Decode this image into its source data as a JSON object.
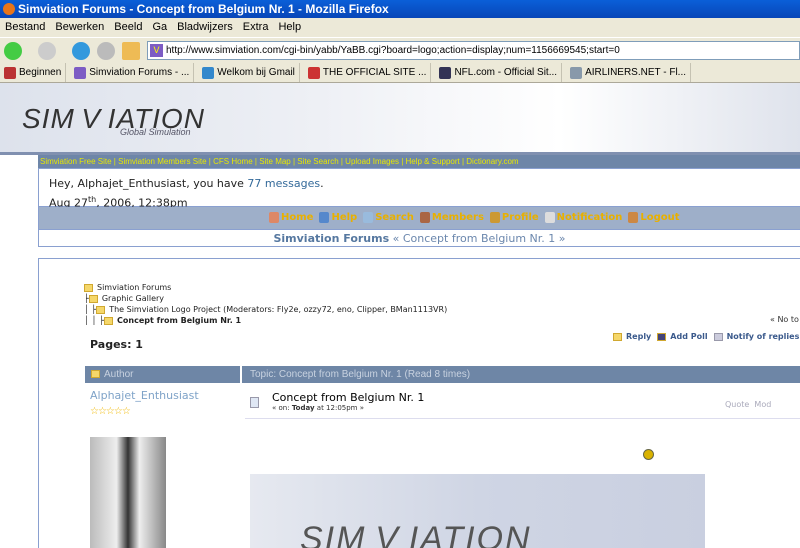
{
  "window": {
    "title": "Simviation Forums - Concept from Belgium Nr. 1 - Mozilla Firefox"
  },
  "menu": [
    "Bestand",
    "Bewerken",
    "Beeld",
    "Ga",
    "Bladwijzers",
    "Extra",
    "Help"
  ],
  "address": "http://www.simviation.com/cgi-bin/yabb/YaBB.cgi?board=logo;action=display;num=1156669545;start=0",
  "bookmarks": [
    "Beginnen",
    "Simviation Forums - ...",
    "Welkom bij Gmail",
    "THE OFFICIAL SITE ...",
    "NFL.com - Official Sit...",
    "AIRLINERS.NET - Fl..."
  ],
  "banner": {
    "logo": "SIM V IATION",
    "tagline": "Global Simulation"
  },
  "linkbar": "Simviation Free Site | Simviation Members Site | CFS Home | Site Map | Site Search | Upload Images | Help & Support | Dictionary.com",
  "welcome": {
    "greeting": "Hey, Alphajet_Enthusiast, you have ",
    "messages": "77 messages",
    "period": ".",
    "date_pre": "Aug 27",
    "date_sup": "th",
    "date_post": ", 2006, 12:38pm"
  },
  "nav": [
    "Home",
    "Help",
    "Search",
    "Members",
    "Profile",
    "Notification",
    "Logout"
  ],
  "crumb": {
    "forum": "Simviation Forums",
    "rest": " « Concept from Belgium Nr. 1 »"
  },
  "tree": [
    "Simviation Forums",
    "Graphic Gallery",
    "The Simviation Logo Project (Moderators: Fly2e, ozzy72, eno, Clipper, BMan1113VR)",
    "Concept from Belgium Nr. 1"
  ],
  "no_topic": "« No to",
  "pages": "Pages: 1",
  "actions": [
    "Reply",
    "Add Poll",
    "Notify of replies"
  ],
  "header": {
    "author": "Author",
    "topic": "Topic: Concept from Belgium Nr. 1  (Read 8 times)"
  },
  "post": {
    "author": "Alphajet_Enthusiast",
    "stars": "☆☆☆☆☆",
    "title": "Concept from Belgium Nr. 1",
    "meta_pre": "« on: ",
    "meta_today": "Today",
    "meta_post": " at 12:05pm »",
    "quote": "Quote",
    "modify": "Mod"
  }
}
